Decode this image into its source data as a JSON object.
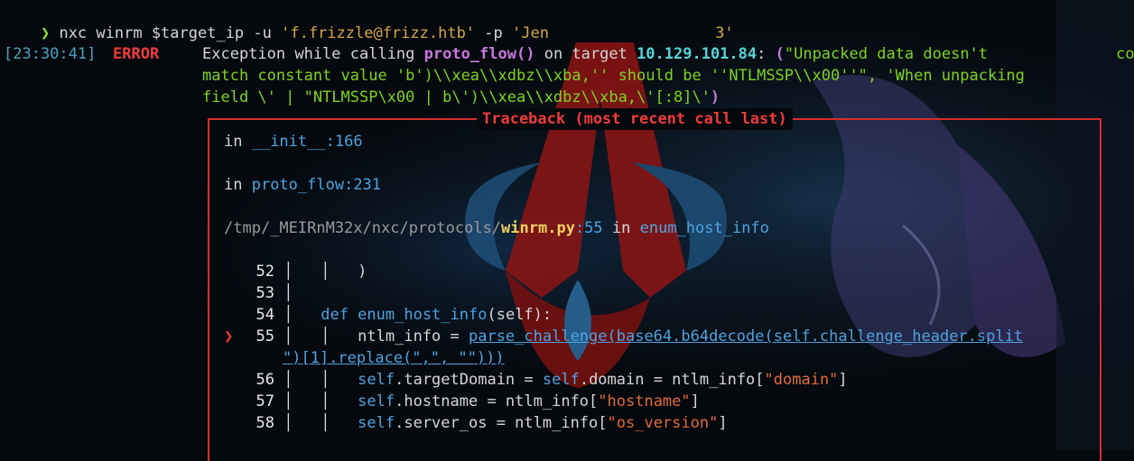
{
  "command": {
    "prompt_symbol": "❯",
    "program": "nxc",
    "args_mid": " winrm $target_ip -u ",
    "user": "'f.frizzle@frizz.htb'",
    "flag_p": " -p ",
    "password_start": "'Jen",
    "password_end": "3'"
  },
  "log": {
    "timestamp": "[23:30:41]",
    "level": "ERROR",
    "msg_prefix": "Exception while calling ",
    "func": "proto_flow()",
    "msg_mid": " on target ",
    "target": "10.129.101.84",
    "msg_colon": ": ",
    "line1_paren": "(",
    "line1_rest": "\"Unpacked data doesn't",
    "line1_tail": "co",
    "line2": "match constant value 'b')\\\\xea\\\\xdbz\\\\xba,'' should be ''NTLMSSP\\\\x00''\", 'When unpacking",
    "line3": "field \\' | \"NTLMSSP\\x00 | b\\')\\\\xea\\\\xdbz\\\\xba,\\'[:8]\\'",
    "line3_paren": ")"
  },
  "traceback": {
    "title": "Traceback (most recent call last)",
    "frame1_in": "in ",
    "frame1_func": "__init__",
    "frame1_line": ":166",
    "frame2_in": "in ",
    "frame2_func": "proto_flow",
    "frame2_line": ":231",
    "frame3_path": "/tmp/_MEIRnM32x/nxc/protocols/",
    "frame3_file": "winrm.py",
    "frame3_line": ":55",
    "frame3_in": " in ",
    "frame3_func": "enum_host_info",
    "code": [
      {
        "n": "52",
        "text": "   )"
      },
      {
        "n": "53",
        "text": ""
      },
      {
        "n": "54",
        "kw": "def ",
        "fn": "enum_host_info",
        "rest": "(",
        "self": "self",
        "end": "):"
      },
      {
        "n": "55",
        "pre": "ntlm_info = ",
        "call": "parse_challenge(base64.b64decode(self.challenge_header.split"
      },
      {
        "n": "",
        "cont": "\")[1].replace(\",\", \"\")))"
      },
      {
        "n": "56",
        "self1": "self",
        "a1": ".targetDomain = ",
        "self2": "self",
        "a2": ".domain = ntlm_info[",
        "s": "\"domain\"",
        "e": "]"
      },
      {
        "n": "57",
        "self1": "self",
        "a1": ".hostname = ntlm_info[",
        "s": "\"hostname\"",
        "e": "]"
      },
      {
        "n": "58",
        "self1": "self",
        "a1": ".server_os = ntlm_info[",
        "s": "\"os_version\"",
        "e": "]"
      }
    ],
    "current_marker": "❯"
  }
}
